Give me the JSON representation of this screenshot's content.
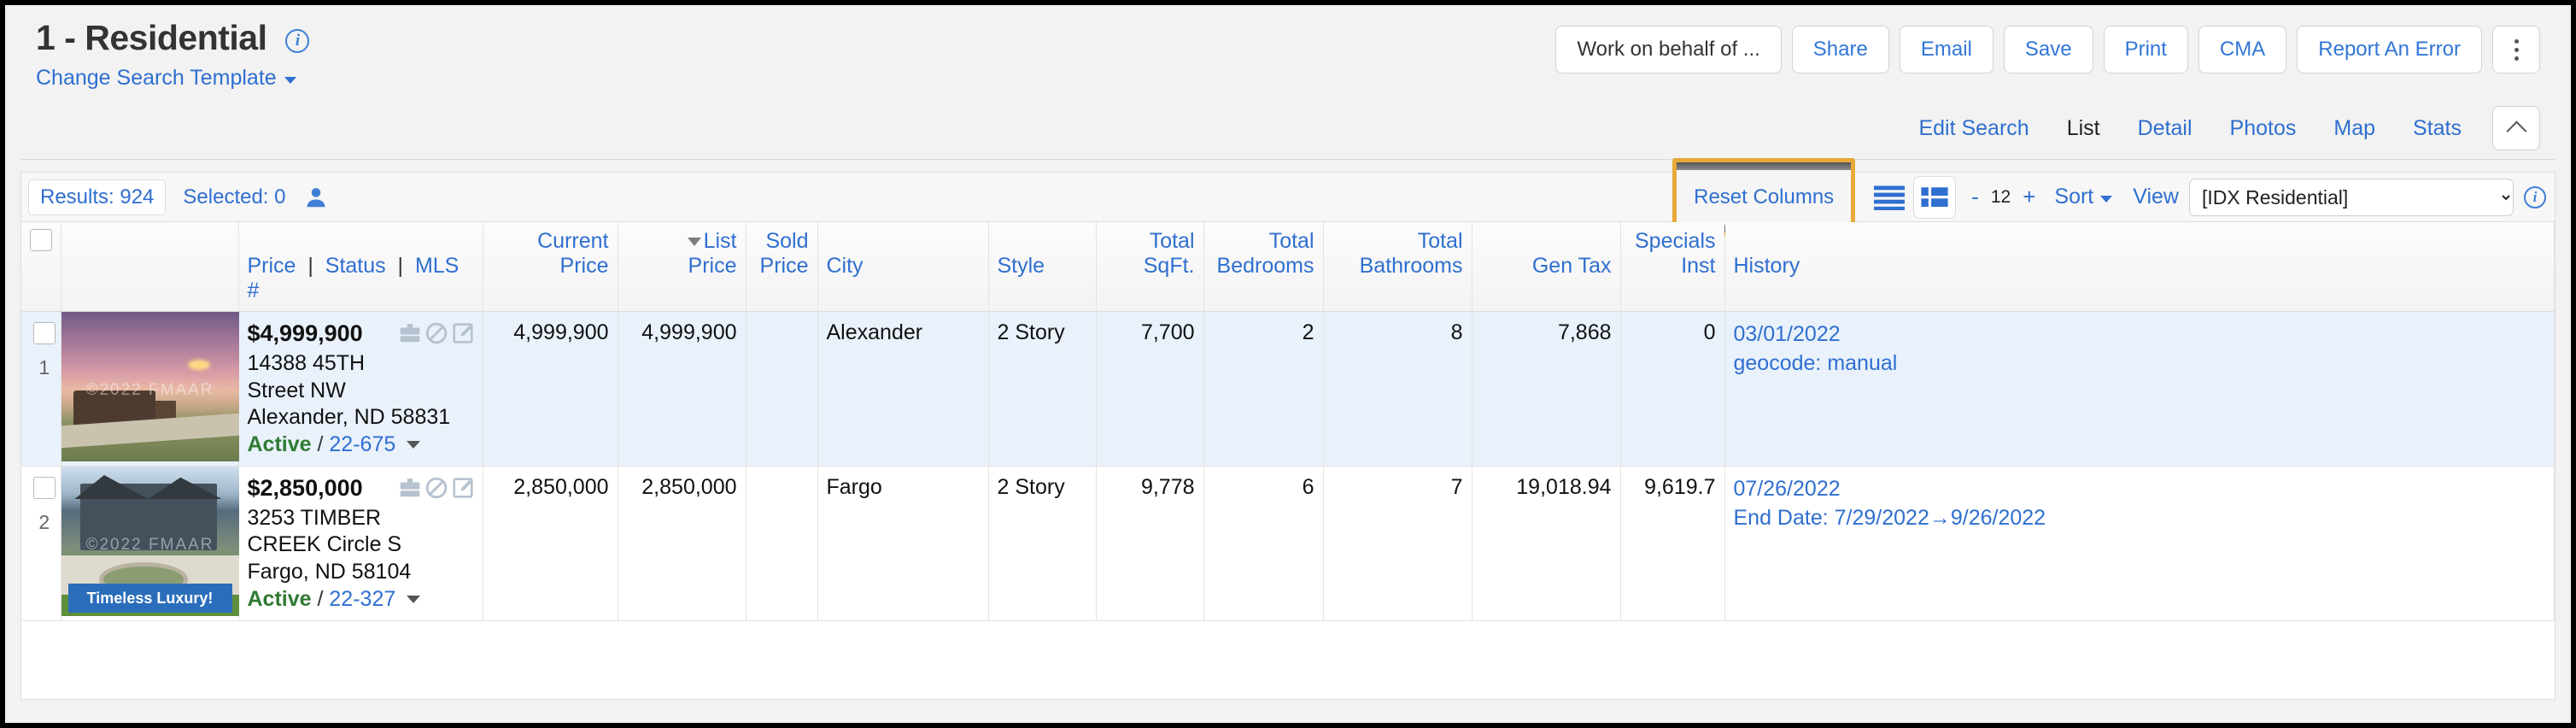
{
  "header": {
    "title": "1 - Residential",
    "info_icon": "info-icon",
    "change_template": "Change Search Template",
    "actions": [
      {
        "label": "Work on behalf of ...",
        "style": "dark"
      },
      {
        "label": "Share",
        "style": "link"
      },
      {
        "label": "Email",
        "style": "link"
      },
      {
        "label": "Save",
        "style": "link"
      },
      {
        "label": "Print",
        "style": "link"
      },
      {
        "label": "CMA",
        "style": "link"
      },
      {
        "label": "Report An Error",
        "style": "link"
      }
    ],
    "kebab_icon": "more-vertical-icon",
    "tabs": [
      {
        "label": "Edit Search",
        "active": false
      },
      {
        "label": "List",
        "active": true
      },
      {
        "label": "Detail",
        "active": false
      },
      {
        "label": "Photos",
        "active": false
      },
      {
        "label": "Map",
        "active": false
      },
      {
        "label": "Stats",
        "active": false
      }
    ],
    "collapse_icon": "chevron-up-icon"
  },
  "toolbar": {
    "results_label": "Results: 924",
    "selected_label": "Selected: 0",
    "person_icon": "person-icon",
    "reset_columns": "Reset Columns",
    "reset_columns_highlight_color": "#e8a93a",
    "list_view_icon": "list-view-icon",
    "grid_view_icon": "grid-view-icon",
    "zoom_minus": "-",
    "zoom_value": "12",
    "zoom_plus": "+",
    "sort_label": "Sort",
    "view_label": "View",
    "view_selected": "[IDX Residential]",
    "view_options": [
      "[IDX Residential]"
    ],
    "view_info_icon": "info-icon"
  },
  "table": {
    "select_all_checkbox": "select-all-checkbox",
    "columns": [
      {
        "id": "price_status_mls",
        "lines": [
          "",
          "Price | Status | MLS #"
        ],
        "align": "left"
      },
      {
        "id": "current_price",
        "lines": [
          "Current",
          "Price"
        ],
        "align": "right"
      },
      {
        "id": "list_price",
        "lines": [
          "List",
          "Price"
        ],
        "align": "right",
        "sorted": "desc"
      },
      {
        "id": "sold_price",
        "lines": [
          "Sold",
          "Price"
        ],
        "align": "right"
      },
      {
        "id": "city",
        "lines": [
          "",
          "City"
        ],
        "align": "left"
      },
      {
        "id": "style",
        "lines": [
          "",
          "Style"
        ],
        "align": "left"
      },
      {
        "id": "total_sqft",
        "lines": [
          "Total",
          "SqFt."
        ],
        "align": "right"
      },
      {
        "id": "total_bedrooms",
        "lines": [
          "Total",
          "Bedrooms"
        ],
        "align": "right"
      },
      {
        "id": "total_bathrooms",
        "lines": [
          "Total",
          "Bathrooms"
        ],
        "align": "right"
      },
      {
        "id": "gen_tax",
        "lines": [
          "",
          "Gen Tax"
        ],
        "align": "right"
      },
      {
        "id": "specials_inst",
        "lines": [
          "Specials",
          "Inst"
        ],
        "align": "right"
      },
      {
        "id": "history",
        "lines": [
          "",
          "History"
        ],
        "align": "left"
      }
    ],
    "header_labels": {
      "price": "Price",
      "status": "Status",
      "mls": "MLS #",
      "current_price_1": "Current",
      "current_price_2": "Price",
      "list_price_1": "List",
      "list_price_2": "Price",
      "sold_price_1": "Sold",
      "sold_price_2": "Price",
      "city": "City",
      "style": "Style",
      "total_sqft_1": "Total",
      "total_sqft_2": "SqFt.",
      "total_bedrooms_1": "Total",
      "total_bedrooms_2": "Bedrooms",
      "total_bathrooms_1": "Total",
      "total_bathrooms_2": "Bathrooms",
      "gen_tax": "Gen Tax",
      "specials_inst_1": "Specials",
      "specials_inst_2": "Inst",
      "history": "History"
    },
    "rows": [
      {
        "row_number": "1",
        "photo": "aerial-dusk-ranch-photo",
        "photo_watermark": "©2022 FMAAR",
        "photo_banner": "",
        "price": "$4,999,900",
        "icons": [
          "briefcase-icon",
          "no-entry-icon",
          "edit-note-icon"
        ],
        "address_line1": "14388 45TH",
        "address_line2": "Street NW",
        "address_line3": "Alexander, ND 58831",
        "status": "Active",
        "mls": "22-675",
        "current_price": "4,999,900",
        "list_price": "4,999,900",
        "sold_price": "",
        "city": "Alexander",
        "style": "2 Story",
        "total_sqft": "7,700",
        "total_bedrooms": "2",
        "total_bathrooms": "8",
        "gen_tax": "7,868",
        "specials_inst": "0",
        "history_line1": "03/01/2022",
        "history_line2": "geocode: manual"
      },
      {
        "row_number": "2",
        "photo": "suburban-two-story-home-photo",
        "photo_watermark": "©2022 FMAAR",
        "photo_banner": "Timeless Luxury!",
        "price": "$2,850,000",
        "icons": [
          "briefcase-icon",
          "no-entry-icon",
          "edit-note-icon"
        ],
        "address_line1": "3253 TIMBER",
        "address_line2": "CREEK Circle S",
        "address_line3": "Fargo, ND 58104",
        "status": "Active",
        "mls": "22-327",
        "current_price": "2,850,000",
        "list_price": "2,850,000",
        "sold_price": "",
        "city": "Fargo",
        "style": "2 Story",
        "total_sqft": "9,778",
        "total_bedrooms": "6",
        "total_bathrooms": "7",
        "gen_tax": "19,018.94",
        "specials_inst": "9,619.7",
        "history_line1": "07/26/2022",
        "history_line2": "End Date: 7/29/2022→9/26/2022"
      }
    ]
  }
}
